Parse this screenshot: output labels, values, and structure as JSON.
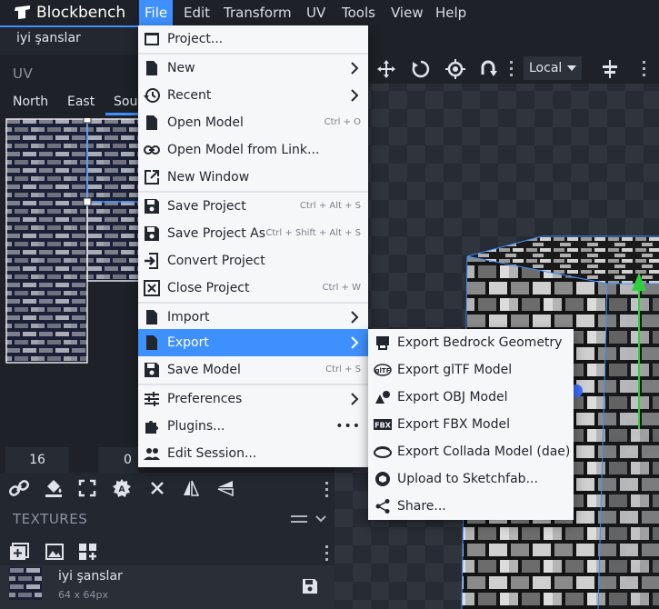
{
  "app": {
    "name": "Blockbench"
  },
  "menubar": {
    "items": [
      "File",
      "Edit",
      "Transform",
      "UV",
      "Tools",
      "View",
      "Help"
    ]
  },
  "tabs": {
    "project": "iyi şanslar"
  },
  "uv": {
    "title": "UV",
    "faces": [
      "North",
      "East",
      "Sou"
    ],
    "values": [
      "16",
      "0"
    ]
  },
  "toolbar": {
    "space": "Local"
  },
  "textures": {
    "title": "TEXTURES",
    "name": "iyi şanslar",
    "size": "64 x 64px"
  },
  "file_menu": {
    "project": "Project...",
    "new": "New",
    "recent": "Recent",
    "open_model": "Open Model",
    "open_model_kb": "Ctrl + O",
    "open_link": "Open Model from Link...",
    "new_window": "New Window",
    "save_project": "Save Project",
    "save_project_kb": "Ctrl + Alt + S",
    "save_project_as": "Save Project As",
    "save_project_as_kb": "Ctrl + Shift + Alt + S",
    "convert_project": "Convert Project",
    "close_project": "Close Project",
    "close_project_kb": "Ctrl + W",
    "import": "Import",
    "export": "Export",
    "save_model": "Save Model",
    "save_model_kb": "Ctrl + S",
    "preferences": "Preferences",
    "plugins": "Plugins...",
    "edit_session": "Edit Session..."
  },
  "export_menu": {
    "bedrock": "Export Bedrock Geometry",
    "gltf": "Export glTF Model",
    "obj": "Export OBJ Model",
    "fbx": "Export FBX Model",
    "collada": "Export Collada Model (dae)",
    "sketchfab": "Upload to Sketchfab...",
    "share": "Share..."
  },
  "colors": {
    "accent": "#3e90ff",
    "background": "#1e2127",
    "menu": "#f6f7f9"
  }
}
